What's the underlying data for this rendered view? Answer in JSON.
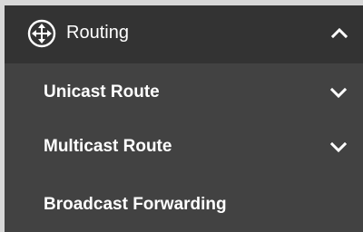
{
  "menu": {
    "header": {
      "label": "Routing",
      "icon": "routing-icon",
      "expand_icon": "chevron-up-icon",
      "expanded": true
    },
    "items": [
      {
        "label": "Unicast Route",
        "icon": "chevron-down-icon"
      },
      {
        "label": "Multicast Route",
        "icon": "chevron-down-icon"
      },
      {
        "label": "Broadcast Forwarding"
      }
    ]
  },
  "colors": {
    "header_background": "#333333",
    "panel_background": "#424242",
    "text": "#ffffff"
  }
}
